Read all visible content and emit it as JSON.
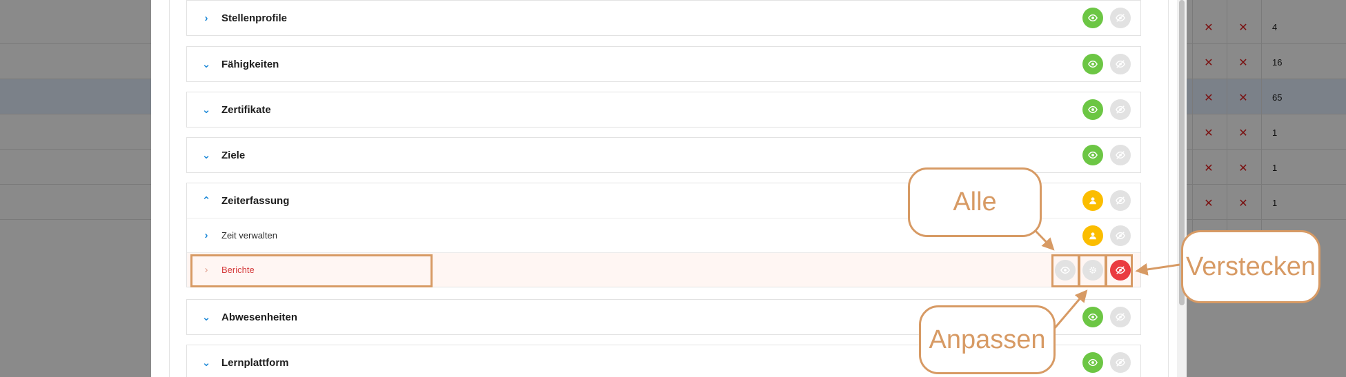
{
  "background_table": {
    "rows": [
      {
        "col_a": "✕",
        "col_b": "✕",
        "count": "4"
      },
      {
        "col_a": "✕",
        "col_b": "✕",
        "count": "16"
      },
      {
        "col_a": "✕",
        "col_b": "✕",
        "count": "65"
      },
      {
        "col_a": "✕",
        "col_b": "✕",
        "count": "1"
      },
      {
        "col_a": "✕",
        "col_b": "✕",
        "count": "1"
      },
      {
        "col_a": "✕",
        "col_b": "✕",
        "count": "1"
      }
    ]
  },
  "sections": [
    {
      "label": "Stellenprofile",
      "chevron": "chevron-right-icon",
      "status": "visible"
    },
    {
      "label": "Fähigkeiten",
      "chevron": "chevron-down-icon",
      "status": "visible"
    },
    {
      "label": "Zertifikate",
      "chevron": "chevron-down-icon",
      "status": "visible"
    },
    {
      "label": "Ziele",
      "chevron": "chevron-down-icon",
      "status": "visible"
    },
    {
      "label": "Zeiterfassung",
      "chevron": "chevron-up-icon",
      "status": "custom",
      "children": [
        {
          "label": "Zeit verwalten",
          "chevron": "chevron-right-icon",
          "status": "custom"
        },
        {
          "label": "Berichte",
          "chevron": "chevron-right-icon",
          "status": "hidden"
        }
      ]
    },
    {
      "label": "Abwesenheiten",
      "chevron": "chevron-down-icon",
      "status": "visible"
    },
    {
      "label": "Lernplattform",
      "chevron": "chevron-down-icon",
      "status": "visible"
    }
  ],
  "annotations": {
    "alle": "Alle",
    "anpassen": "Anpassen",
    "verstecken": "Verstecken"
  },
  "colors": {
    "visible_green": "#6cc644",
    "custom_amber": "#fbbd00",
    "hidden_red": "#ea3b40",
    "inactive_grey": "#e2e2e2",
    "annotation_orange": "#d79a64",
    "chevron_blue": "#1f8ad8"
  }
}
